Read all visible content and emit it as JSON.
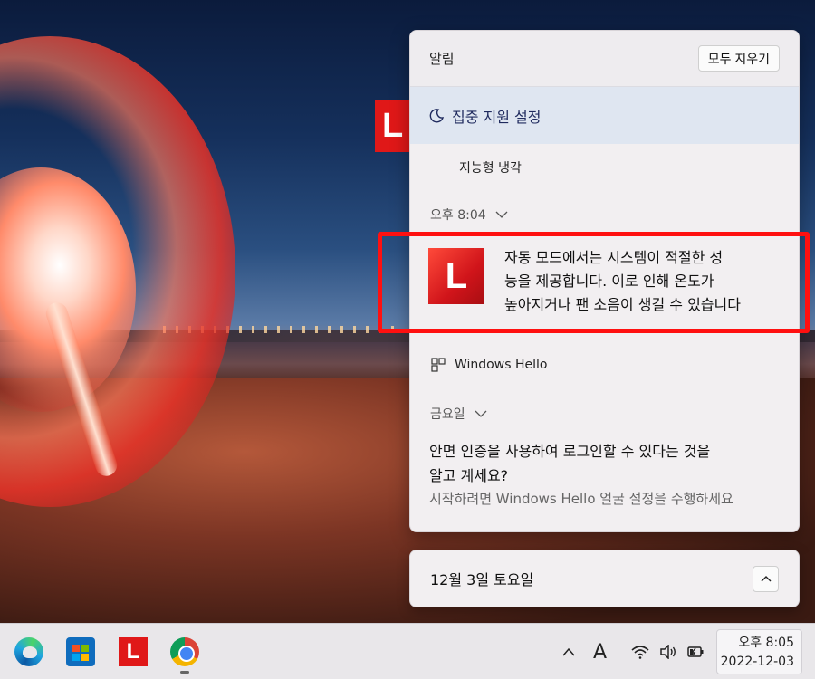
{
  "notification_center": {
    "title": "알림",
    "clear_all_label": "모두 지우기",
    "focus_assist_label": "집중 지원 설정",
    "app_group_label": "지능형 냉각",
    "group1_time": "오후 8:04",
    "notification1": {
      "app_logo": "L",
      "lines": [
        "자동 모드에서는 시스템이 적절한 성",
        "능을 제공합니다. 이로 인해 온도가",
        "높아지거나 팬 소음이 생길 수 있습니다"
      ]
    },
    "windows_hello_label": "Windows Hello",
    "group2_day": "금요일",
    "notification2": {
      "lines": [
        "안면 인증을 사용하여 로그인할 수 있다는 것을",
        "알고 계세요?"
      ],
      "sub": "시작하려면 Windows Hello 얼굴 설정을 수행하세요"
    }
  },
  "calendar": {
    "date_label": "12월 3일 토요일"
  },
  "taskbar": {
    "apps": [
      "edge-icon",
      "store-icon",
      "lenovo-icon",
      "chrome-icon"
    ],
    "lenovo_letter": "L",
    "ime_label": "A",
    "clock_time": "오후 8:05",
    "clock_date": "2022-12-03"
  },
  "wallpaper": {
    "lenovo_letter": "L"
  },
  "colors": {
    "accent_red": "#ff1010",
    "lenovo_red": "#e01818"
  }
}
